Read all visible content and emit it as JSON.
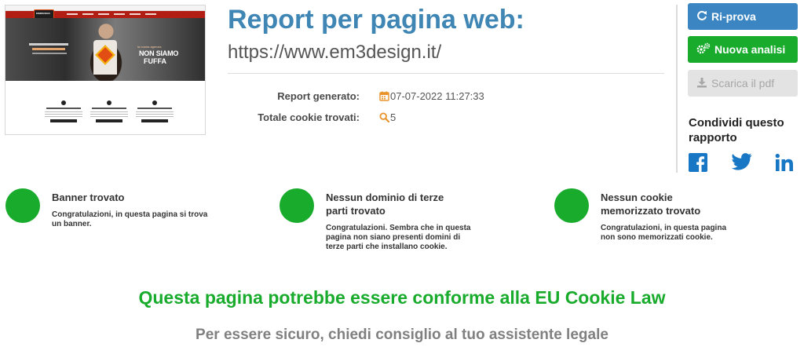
{
  "report": {
    "title": "Report per pagina web:",
    "url": "https://www.em3design.it/",
    "generated_label": "Report generato:",
    "generated_value": "07-07-2022 11:27:33",
    "cookies_label": "Totale cookie trovati:",
    "cookies_value": "5"
  },
  "thumbnail": {
    "logo_text": "EM3DESIGN",
    "hero_small": "la nostra agenzia",
    "hero_line1": "NON SIAMO",
    "hero_line2": "FUFFA"
  },
  "actions": {
    "retry_label": "Ri-prova",
    "new_label": "Nuova analisi",
    "pdf_label": "Scarica il pdf"
  },
  "share": {
    "title": "Condividi questo rapporto",
    "icons": [
      "facebook-icon",
      "twitter-icon",
      "linkedin-icon"
    ]
  },
  "results": [
    {
      "title": "Banner trovato",
      "desc": "Congratulazioni, in questa pagina si trova un banner."
    },
    {
      "title": "Nessun dominio di terze parti trovato",
      "desc": "Congratulazioni. Sembra che in questa pagina non siano presenti domini di terze parti che installano cookie."
    },
    {
      "title": "Nessun cookie memorizzato trovato",
      "desc": "Congratulazioni, in questa pagina non sono memorizzati cookie."
    }
  ],
  "verdict": {
    "headline": "Questa pagina potrebbe essere conforme alla EU Cookie Law",
    "advice": "Per essere sicuro, chiedi consiglio al tuo assistente legale"
  },
  "colors": {
    "title_blue": "#3f86b4",
    "success_green": "#18ab2c",
    "retry_blue": "#3b86c2",
    "disabled_gray": "#e3e3e3",
    "calendar_orange": "#e8932a",
    "facebook_blue": "#1877c4"
  }
}
